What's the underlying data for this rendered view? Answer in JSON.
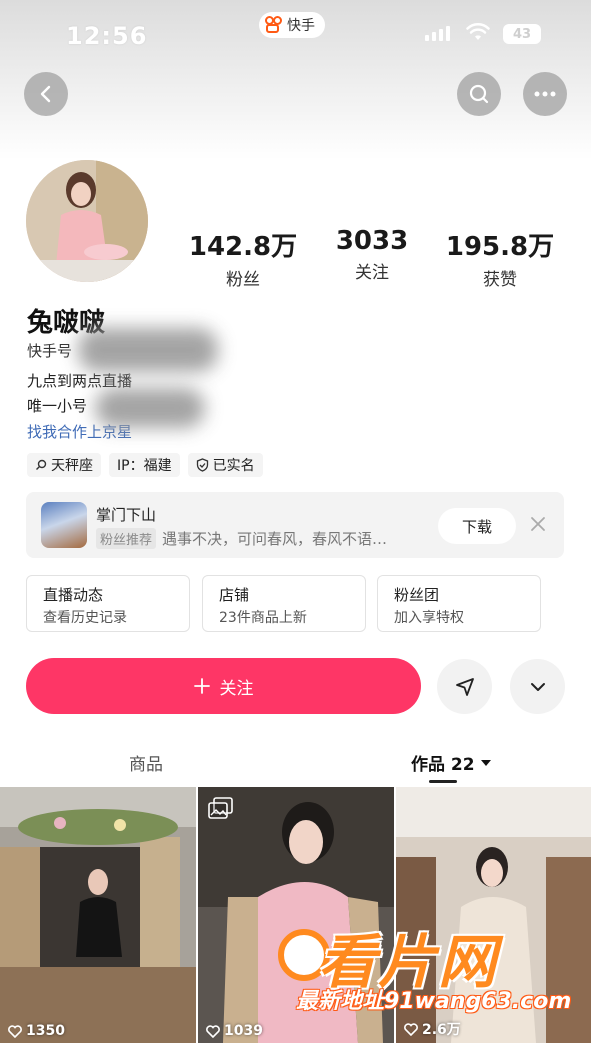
{
  "status_bar": {
    "time": "12:56",
    "app_name": "快手",
    "battery": "43",
    "icons": [
      "signal-icon",
      "wifi-icon",
      "battery-icon"
    ]
  },
  "nav": {
    "icons": [
      "back-icon",
      "search-icon",
      "more-icon"
    ]
  },
  "profile": {
    "stats": [
      {
        "value": "142.8万",
        "label": "粉丝"
      },
      {
        "value": "3033",
        "label": "关注"
      },
      {
        "value": "195.8万",
        "label": "获赞"
      }
    ],
    "name": "兔啵啵",
    "kuaishou_id_label": "快手号",
    "bio_line1": "九点到两点直播",
    "bio_line2": "唯一小号",
    "contact": "找我合作上京星",
    "tags": [
      {
        "icon": "search-icon",
        "text": "天秤座"
      },
      {
        "icon": "",
        "text": "IP：福建"
      },
      {
        "icon": "verified-icon",
        "text": "已实名"
      }
    ]
  },
  "game_card": {
    "title": "掌门下山",
    "badge": "粉丝推荐",
    "description": "遇事不决，可问春风，春风不语…",
    "download_label": "下载"
  },
  "features": [
    {
      "title": "直播动态",
      "subtitle": "查看历史记录"
    },
    {
      "title": "店铺",
      "subtitle": "23件商品上新"
    },
    {
      "title": "粉丝团",
      "subtitle": "加入享特权"
    }
  ],
  "follow": {
    "label": "关注",
    "icons": [
      "plus-icon",
      "send-icon",
      "chevron-down-icon"
    ]
  },
  "tabs": [
    {
      "label": "商品",
      "active": false
    },
    {
      "label": "作品 22",
      "active": true
    }
  ],
  "posts": [
    {
      "likes": "1350",
      "multi_image": false
    },
    {
      "likes": "1039",
      "multi_image": true
    },
    {
      "likes": "2.6万",
      "multi_image": false
    }
  ],
  "watermark": {
    "main": "看片网",
    "sub": "最新地址91wang63.com"
  },
  "colors": {
    "accent": "#fe3666",
    "link": "#3f6bb6",
    "brand": "#ff5a14"
  }
}
